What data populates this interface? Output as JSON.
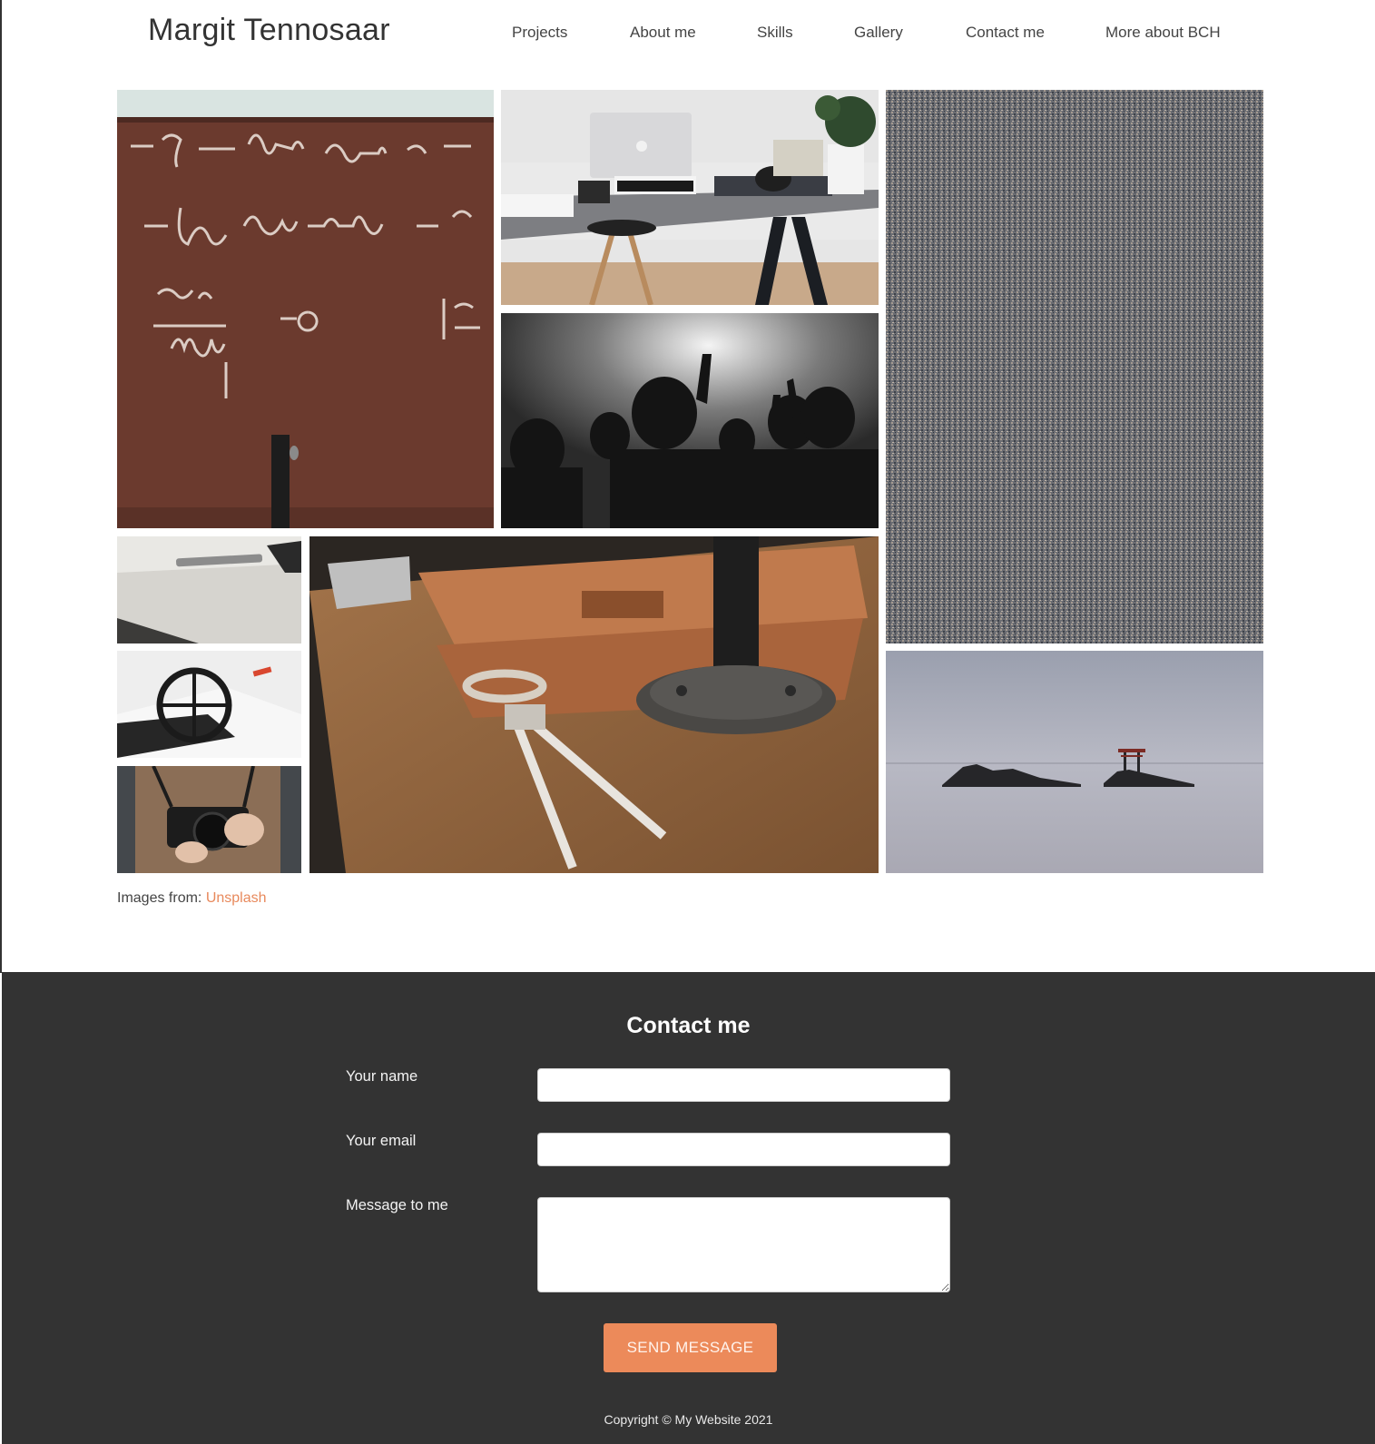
{
  "header": {
    "brand": "Margit Tennosaar",
    "nav": [
      "Projects",
      "About me",
      "Skills",
      "Gallery",
      "Contact me",
      "More about BCH"
    ]
  },
  "gallery": {
    "credit_prefix": "Images from: ",
    "credit_link": "Unsplash"
  },
  "contact": {
    "title": "Contact me",
    "name_label": "Your name",
    "email_label": "Your email",
    "message_label": "Message to me",
    "name_value": "",
    "email_value": "",
    "message_value": "",
    "send_label": "SEND MESSAGE",
    "copyright": "Copyright © My Website 2021"
  },
  "colors": {
    "accent": "#ec8a5a",
    "footer_bg": "#333333"
  }
}
